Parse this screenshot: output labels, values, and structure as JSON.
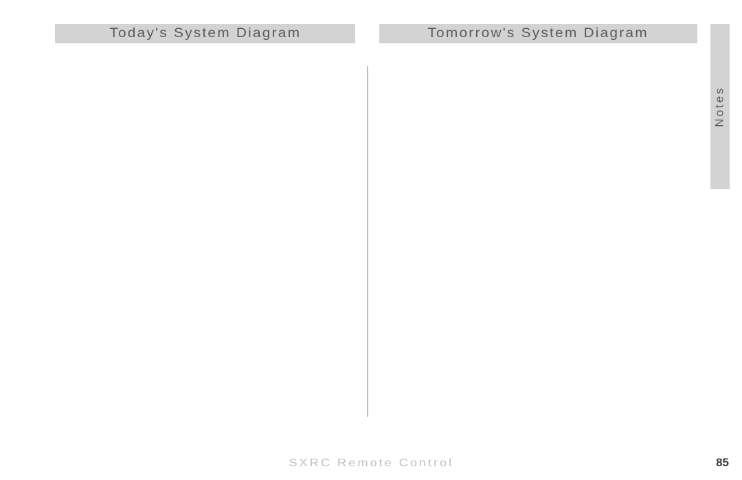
{
  "headers": {
    "left": "Today's System Diagram",
    "right": "Tomorrow's System Diagram"
  },
  "sideTab": "Notes",
  "footer": {
    "title": "SXRC Remote Control",
    "pageNumber": "85"
  }
}
